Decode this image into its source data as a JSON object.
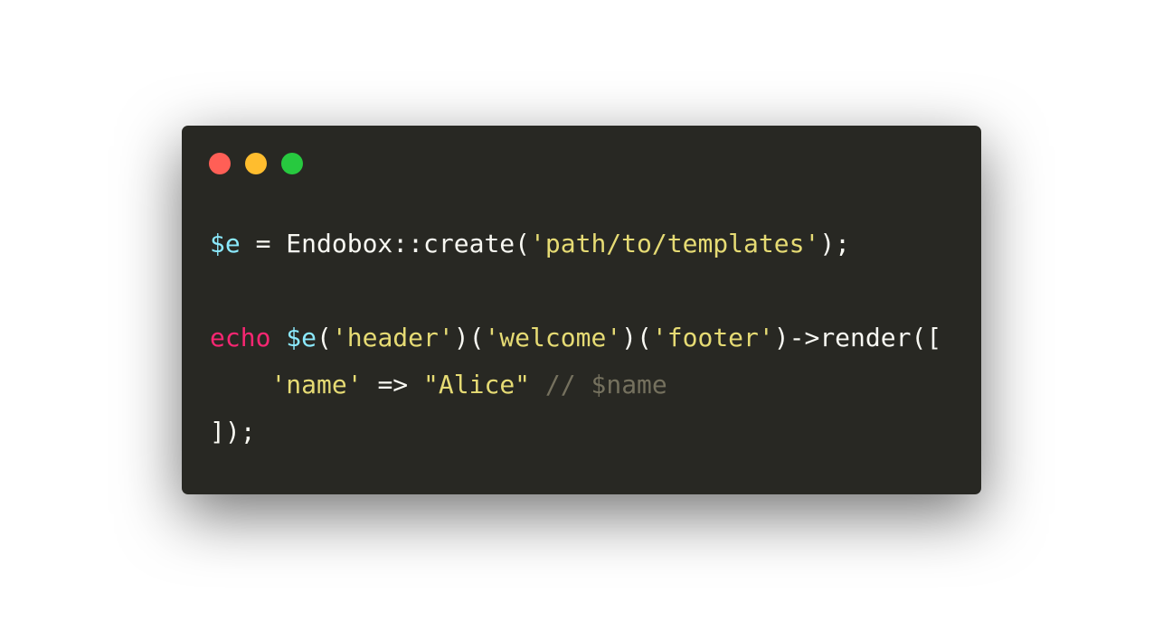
{
  "window": {
    "traffic_lights": [
      {
        "name": "close",
        "color": "#ff5f56"
      },
      {
        "name": "minimize",
        "color": "#ffbd2e"
      },
      {
        "name": "maximize",
        "color": "#27c93f"
      }
    ]
  },
  "code": {
    "lines": [
      [
        {
          "text": "$e",
          "color": "#8be9fd"
        },
        {
          "text": " = Endobox::create(",
          "color": "#f8f8f2"
        },
        {
          "text": "'path/to/templates'",
          "color": "#e6db74"
        },
        {
          "text": ");",
          "color": "#f8f8f2"
        }
      ],
      [],
      [
        {
          "text": "echo",
          "color": "#f92672"
        },
        {
          "text": " ",
          "color": "#f8f8f2"
        },
        {
          "text": "$e",
          "color": "#8be9fd"
        },
        {
          "text": "(",
          "color": "#f8f8f2"
        },
        {
          "text": "'header'",
          "color": "#e6db74"
        },
        {
          "text": ")(",
          "color": "#f8f8f2"
        },
        {
          "text": "'welcome'",
          "color": "#e6db74"
        },
        {
          "text": ")(",
          "color": "#f8f8f2"
        },
        {
          "text": "'footer'",
          "color": "#e6db74"
        },
        {
          "text": ")->render([",
          "color": "#f8f8f2"
        }
      ],
      [
        {
          "text": "    ",
          "color": "#f8f8f2"
        },
        {
          "text": "'name'",
          "color": "#e6db74"
        },
        {
          "text": " => ",
          "color": "#f8f8f2"
        },
        {
          "text": "\"Alice\"",
          "color": "#e6db74"
        },
        {
          "text": " ",
          "color": "#f8f8f2"
        },
        {
          "text": "// $name",
          "color": "#75715e"
        }
      ],
      [
        {
          "text": "]);",
          "color": "#f8f8f2"
        }
      ]
    ]
  }
}
